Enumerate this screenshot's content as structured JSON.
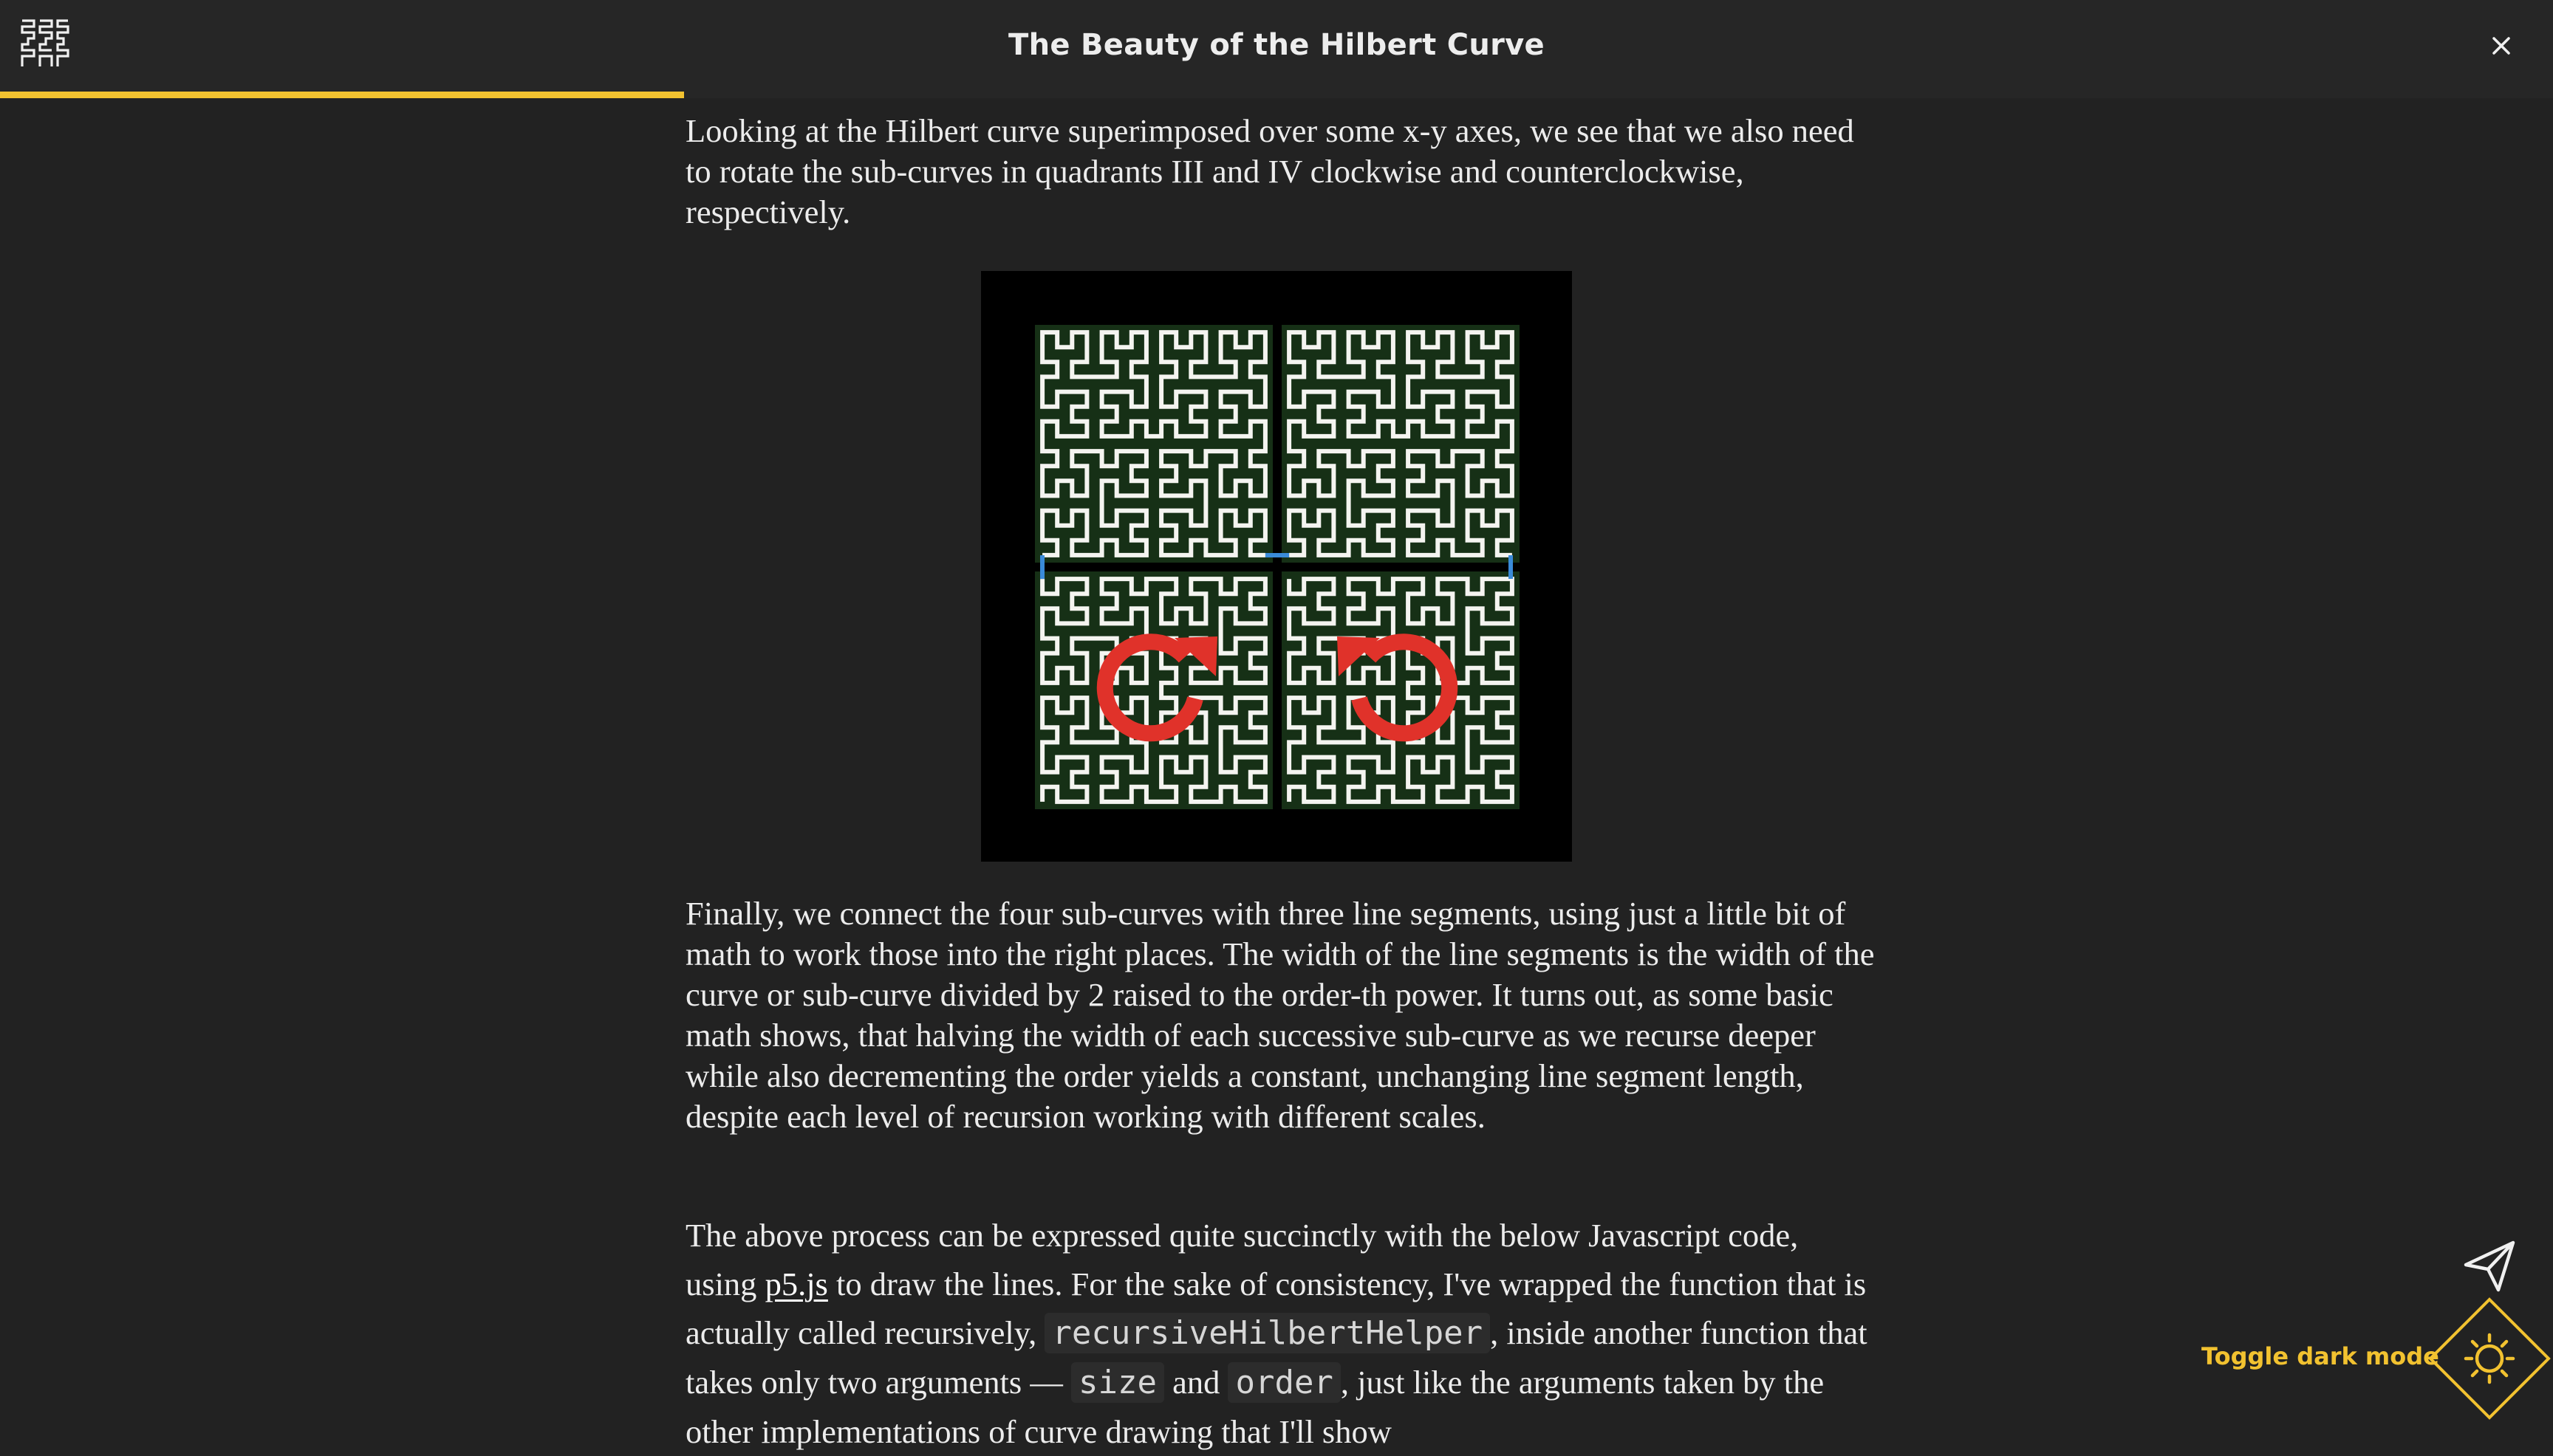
{
  "header": {
    "title": "The Beauty of the Hilbert Curve",
    "logo_icon": "hilbert-curve-logo-icon",
    "close_icon": "close-icon"
  },
  "reading_progress": {
    "fraction": 0.268,
    "color": "#f2c230"
  },
  "article": {
    "paragraph_1": "Looking at the Hilbert curve superimposed over some x-y axes, we see that we also need to rotate the sub-curves in quadrants III and IV clockwise and counterclockwise, respectively.",
    "paragraph_2": "Finally, we connect the four sub-curves with three line segments, using just a little bit of math to work those into the right places. The width of the line segments is the width of the curve or sub-curve divided by 2 raised to the order-th power. It turns out, as some basic math shows, that halving the width of each successive sub-curve as we recurse deeper while also decrementing the order yields a constant, unchanging line segment length, despite each level of recursion working with different scales.",
    "paragraph_3": {
      "t1": "The above process can be expressed quite succinctly with the below Javascript code, using ",
      "link": "p5.js",
      "t2": " to draw the lines. For the sake of consistency, I've wrapped the function that is actually called recursively, ",
      "code_1": "recursiveHilbertHelper",
      "t3": ", inside another function that takes only two arguments — ",
      "code_2": "size",
      "t4": " and ",
      "code_3": "order",
      "t5": ", just like the arguments taken by the other implementations of curve drawing that I'll show"
    }
  },
  "figure": {
    "icons": [
      "rotate-clockwise-icon",
      "rotate-counterclockwise-icon"
    ],
    "colors": {
      "background": "#000000",
      "quadrant_fill": "#163016",
      "curve": "#f4f4f0",
      "connector": "#3a8bd9",
      "arrow": "#e0322a"
    }
  },
  "controls": {
    "toggle_dark_mode_label": "Toggle dark mode",
    "share_icon": "paper-plane-icon",
    "toggle_icon": "sun-icon",
    "accent": "#f2c230"
  }
}
